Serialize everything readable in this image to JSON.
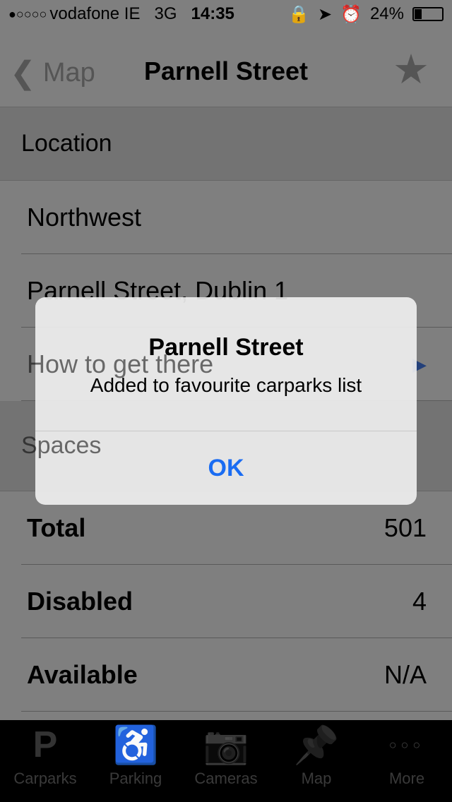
{
  "status_bar": {
    "signal": "●○○○○",
    "carrier": "vodafone IE",
    "network": "3G",
    "time": "14:35",
    "battery": "24%",
    "battery_level": 0.24
  },
  "nav": {
    "back_label": "Map",
    "title": "Parnell Street",
    "favourite_icon": "star-icon"
  },
  "location": {
    "header": "Location",
    "region": "Northwest",
    "address": "Parnell Street, Dublin 1",
    "directions": "How to get there"
  },
  "spaces": {
    "header": "Spaces",
    "rows": [
      {
        "label": "Total",
        "value": "501"
      },
      {
        "label": "Disabled",
        "value": "4"
      },
      {
        "label": "Available",
        "value": "N/A"
      }
    ]
  },
  "tabs": [
    {
      "label": "Carparks",
      "icon": "P"
    },
    {
      "label": "Parking",
      "icon": "♿"
    },
    {
      "label": "Cameras",
      "icon": "📷"
    },
    {
      "label": "Map",
      "icon": "📌"
    },
    {
      "label": "More",
      "icon": "○○○"
    }
  ],
  "alert": {
    "title": "Parnell Street",
    "message": "Added to favourite carparks list",
    "ok": "OK"
  }
}
